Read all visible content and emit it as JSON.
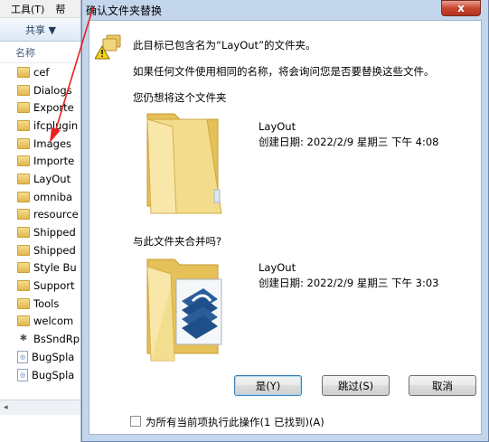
{
  "explorer": {
    "menu": [
      "工具(T)",
      "帮"
    ],
    "toolbar_share": "共享 ▼",
    "column_name": "名称",
    "items": [
      {
        "label": "cef",
        "kind": "folder"
      },
      {
        "label": "Dialogs",
        "kind": "folder"
      },
      {
        "label": "Exporte",
        "kind": "folder"
      },
      {
        "label": "ifcplugin",
        "kind": "folder"
      },
      {
        "label": "Images",
        "kind": "folder"
      },
      {
        "label": "Importe",
        "kind": "folder"
      },
      {
        "label": "LayOut",
        "kind": "folder"
      },
      {
        "label": "omniba",
        "kind": "folder"
      },
      {
        "label": "resource",
        "kind": "folder"
      },
      {
        "label": "Shipped",
        "kind": "folder"
      },
      {
        "label": "Shipped",
        "kind": "folder"
      },
      {
        "label": "Style Bu",
        "kind": "folder"
      },
      {
        "label": "Support",
        "kind": "folder"
      },
      {
        "label": "Tools",
        "kind": "folder"
      },
      {
        "label": "welcom",
        "kind": "folder"
      },
      {
        "label": "BsSndRp",
        "kind": "exe"
      },
      {
        "label": "BugSpla",
        "kind": "doc"
      },
      {
        "label": "BugSpla",
        "kind": "doc"
      }
    ],
    "scroll_left_glyph": "◂"
  },
  "dialog": {
    "title": "确认文件夹替换",
    "close_glyph": "x",
    "message_line1": "此目标已包含名为“LayOut”的文件夹。",
    "message_line2": "如果任何文件使用相同的名称，将会询问您是否要替换这些文件。",
    "question_keep": "您仍想将这个文件夹",
    "existing_folder": {
      "name": "LayOut",
      "created": "创建日期: 2022/2/9 星期三 下午 4:08"
    },
    "question_merge": "与此文件夹合并吗?",
    "new_folder": {
      "name": "LayOut",
      "created": "创建日期: 2022/2/9 星期三 下午 3:03"
    },
    "buttons": {
      "yes": "是(Y)",
      "skip": "跳过(S)",
      "cancel": "取消"
    },
    "apply_all_label": "为所有当前项执行此操作(1 已找到)(A)"
  },
  "colors": {
    "accent_arrow": "#e8211f",
    "title_bar": "#c4d6ec",
    "close_red": "#c9452f"
  }
}
